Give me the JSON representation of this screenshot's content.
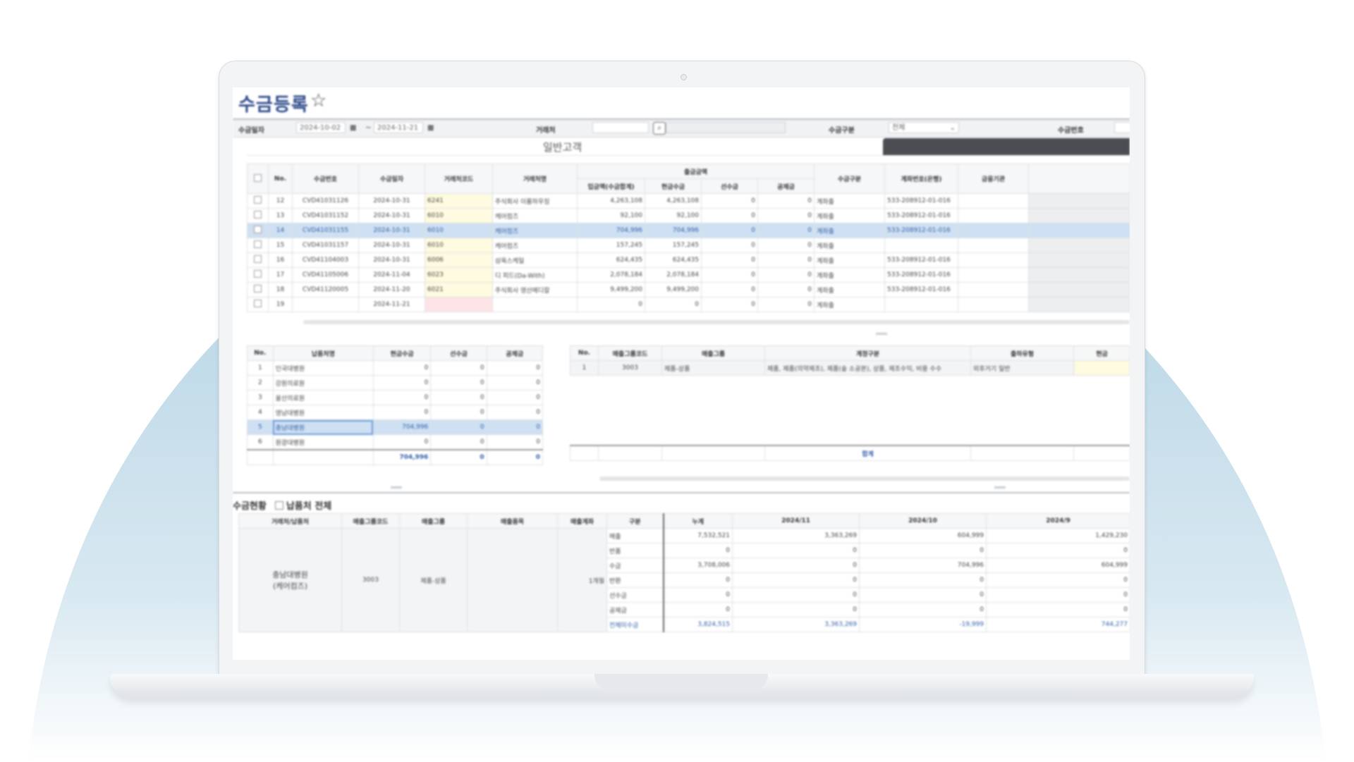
{
  "title": "수금등록",
  "star_icon": "☆",
  "filter": {
    "date_label": "수금일자",
    "date_from": "2024-10-02",
    "date_sep": "~",
    "date_to": "2024-11-21",
    "customer_label": "거래처",
    "type_label": "수금구분",
    "type_value": "전체",
    "number_label": "수금번호"
  },
  "customer_type": "일반고객",
  "grid1": {
    "headers": [
      "No.",
      "수금번호",
      "수금일자",
      "거래처코드",
      "거래처명",
      "입금액(수금합계)",
      "현금수금",
      "선수금",
      "공제금",
      "수금구분",
      "계좌번호(은행)",
      "금융기관"
    ],
    "group_header": "출금금액",
    "rows": [
      [
        "12",
        "CVD41031126",
        "2024-10-31",
        "6241",
        "주식회사 이룸하우징",
        "4,263,108",
        "4,263,108",
        "0",
        "0",
        "계좌출",
        "533-208912-01-016"
      ],
      [
        "13",
        "CVD41031152",
        "2024-10-31",
        "6010",
        "케어컴즈",
        "92,100",
        "92,100",
        "0",
        "0",
        "계좌출",
        "533-208912-01-016"
      ],
      [
        "14",
        "CVD41031155",
        "2024-10-31",
        "6010",
        "케어컴즈",
        "704,996",
        "704,996",
        "0",
        "0",
        "계좌출",
        "533-208912-01-016"
      ],
      [
        "15",
        "CVD41031157",
        "2024-10-31",
        "6010",
        "케어컴즈",
        "157,245",
        "157,245",
        "0",
        "0",
        "계좌출",
        ""
      ],
      [
        "16",
        "CVD41104003",
        "2024-10-31",
        "6006",
        "삼육스케일",
        "624,435",
        "624,435",
        "0",
        "0",
        "계좌출",
        "533-208912-01-016"
      ],
      [
        "17",
        "CVD41105006",
        "2024-11-04",
        "6023",
        "디 피드(Da-With)",
        "2,078,184",
        "2,078,184",
        "0",
        "0",
        "계좌출",
        "533-208912-01-016"
      ],
      [
        "18",
        "CVD41120005",
        "2024-11-20",
        "6021",
        "주식회사 영산메디칼",
        "9,499,200",
        "9,499,200",
        "0",
        "0",
        "계좌출",
        "533-208912-01-016"
      ],
      [
        "19",
        "",
        "2024-11-21",
        "",
        "",
        "0",
        "0",
        "0",
        "0",
        "계좌출",
        ""
      ]
    ]
  },
  "grid2": {
    "headers": [
      "No.",
      "납품처명",
      "현금수금",
      "선수금",
      "공제금"
    ],
    "rows": [
      [
        "1",
        "인국대병원",
        "0",
        "0",
        "0"
      ],
      [
        "2",
        "강원의료원",
        "0",
        "0",
        "0"
      ],
      [
        "3",
        "울산의료원",
        "0",
        "0",
        "0"
      ],
      [
        "4",
        "영남대병원",
        "0",
        "0",
        "0"
      ],
      [
        "5",
        "충남대병원",
        "704,996",
        "0",
        "0"
      ],
      [
        "6",
        "원광대병원",
        "0",
        "0",
        "0"
      ]
    ],
    "totals": [
      "704,996",
      "0",
      "0"
    ]
  },
  "grid3": {
    "headers": [
      "No.",
      "매출그룹코드",
      "매출그룹",
      "계정구분",
      "출하유형",
      "현금"
    ],
    "rows": [
      [
        "1",
        "3003",
        "제품-상품",
        "제품, 제품(의약제조), 제품(숲 소공본), 상품, 제조수익, 비용 수수",
        "외후거기 일반",
        ""
      ]
    ],
    "total_label": "합계"
  },
  "section4": {
    "label": "수금현황",
    "checkbox_label": "납품처 전체"
  },
  "grid4": {
    "headers": [
      "거래처/납품처",
      "매출그룹코드",
      "매출그룹",
      "매출품목",
      "매출계좌",
      "구분",
      "누계",
      "2024/11",
      "2024/10",
      "2024/9"
    ],
    "customer": "충남대병원\n(케어컴즈)",
    "group_code": "3003",
    "group": "제품-상품",
    "term": "1개월",
    "rows": [
      [
        "매출",
        "7,532,521",
        "3,363,269",
        "604,999",
        "1,429,230"
      ],
      [
        "반품",
        "0",
        "0",
        "0",
        "0"
      ],
      [
        "수금",
        "3,708,006",
        "0",
        "704,996",
        "604,999"
      ],
      [
        "반환",
        "0",
        "0",
        "0",
        "0"
      ],
      [
        "선수금",
        "0",
        "0",
        "0",
        "0"
      ],
      [
        "공제금",
        "0",
        "0",
        "0",
        "0"
      ],
      [
        "전체미수금",
        "3,824,515",
        "3,363,269",
        "-19,999",
        "744,277"
      ]
    ]
  },
  "colors": {
    "accent": "#2d4a8a",
    "selected_row": "#cfe0f2",
    "highlight_yellow": "#fffbe0",
    "backdrop_blue": "#a9cde0"
  }
}
